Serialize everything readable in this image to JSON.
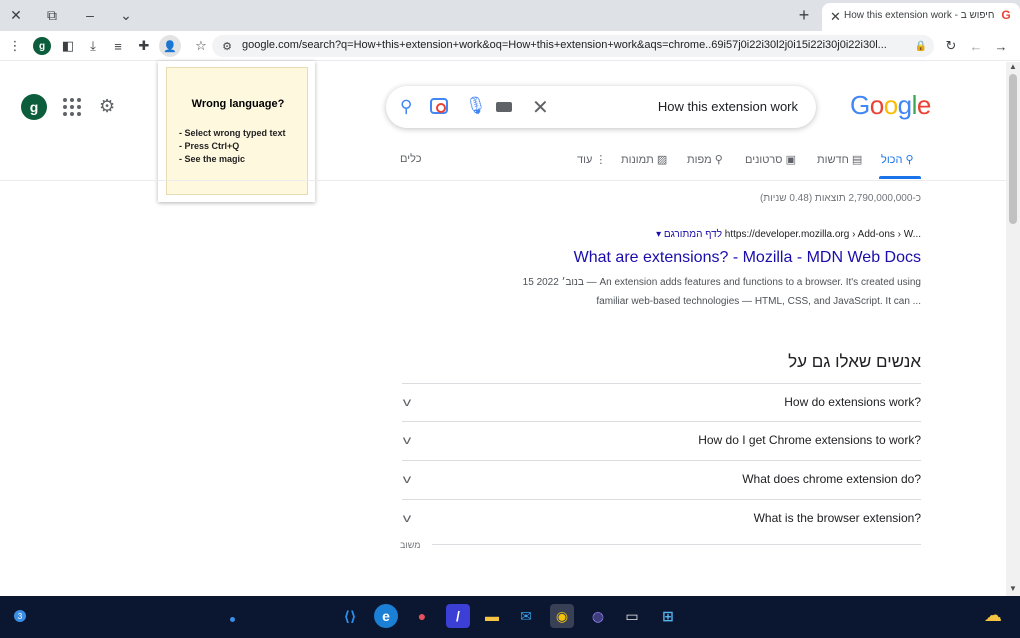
{
  "window": {
    "tab_title": "How this extension work - חיפוש ב",
    "new_tab": "+",
    "close": "✕"
  },
  "toolbar": {
    "profile_initial": "g",
    "url": "google.com/search?q=How+this+extension+work&oq=How+this+extension+work&aqs=chrome..69i57j0i22i30l2j0i15i22i30j0i22i30l..."
  },
  "extension_popup": {
    "title": "Wrong language?",
    "lines": [
      "- Select wrong typed text",
      "- Press Ctrl+Q",
      "- See the magic"
    ]
  },
  "page": {
    "profile_initial": "g",
    "search": {
      "query": "How this extension work"
    },
    "logo": "Google",
    "nav": {
      "all": "הכול",
      "news": "חדשות",
      "videos": "סרטונים",
      "maps": "מפות",
      "images": "תמונות",
      "more": "עוד",
      "tools": "כלים"
    },
    "stats": "כ-2,790,000,000 תוצאות (0.48 שניות)",
    "result": {
      "breadcrumb": "https://developer.mozilla.org › Add-ons › W...",
      "translate": "▾ לדף המתורגם",
      "title": "What are extensions? - Mozilla - MDN Web Docs",
      "snippet_line1": "15 בנוב׳ 2022 — An extension adds features and functions to a browser. It's created using",
      "snippet_line2": "familiar web-based technologies — HTML, CSS, and JavaScript. It can ..."
    },
    "paa": {
      "heading": "אנשים שאלו גם על",
      "questions": [
        "How do extensions work?",
        "How do I get Chrome extensions to work?",
        "What does chrome extension do?",
        "What is the browser extension?"
      ],
      "feedback": "משוב"
    }
  },
  "taskbar": {
    "badge": "3"
  },
  "colors": {
    "link": "#1a0dab",
    "accent": "#1a73e8",
    "popup_bg": "#fef8df",
    "taskbar": "#0b1730"
  }
}
